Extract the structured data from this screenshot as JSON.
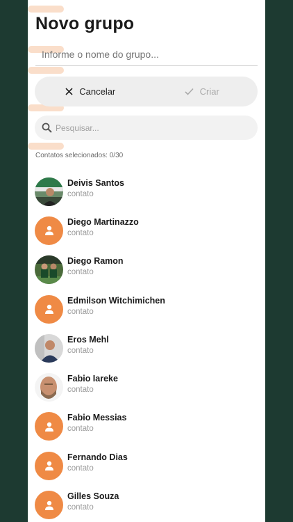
{
  "header": {
    "title": "Novo grupo"
  },
  "group_name": {
    "placeholder": "Informe o nome do grupo..."
  },
  "actions": {
    "cancel_label": "Cancelar",
    "create_label": "Criar"
  },
  "search": {
    "placeholder": "Pesquisar..."
  },
  "selection": {
    "count_text": "Contatos selecionados: 0/30"
  },
  "colors": {
    "accent": "#ef8a45",
    "background": "#1d3a31"
  },
  "contacts": [
    {
      "name": "Deivis Santos",
      "subtitle": "contato",
      "avatar": "photo"
    },
    {
      "name": "Diego Martinazzo",
      "subtitle": "contato",
      "avatar": "placeholder"
    },
    {
      "name": "Diego Ramon",
      "subtitle": "contato",
      "avatar": "photo"
    },
    {
      "name": "Edmilson Witchimichen",
      "subtitle": "contato",
      "avatar": "placeholder"
    },
    {
      "name": "Eros Mehl",
      "subtitle": "contato",
      "avatar": "photo"
    },
    {
      "name": "Fabio Iareke",
      "subtitle": "contato",
      "avatar": "photo"
    },
    {
      "name": "Fabio Messias",
      "subtitle": "contato",
      "avatar": "placeholder"
    },
    {
      "name": "Fernando Dias",
      "subtitle": "contato",
      "avatar": "placeholder"
    },
    {
      "name": "Gilles Souza",
      "subtitle": "contato",
      "avatar": "placeholder"
    }
  ]
}
